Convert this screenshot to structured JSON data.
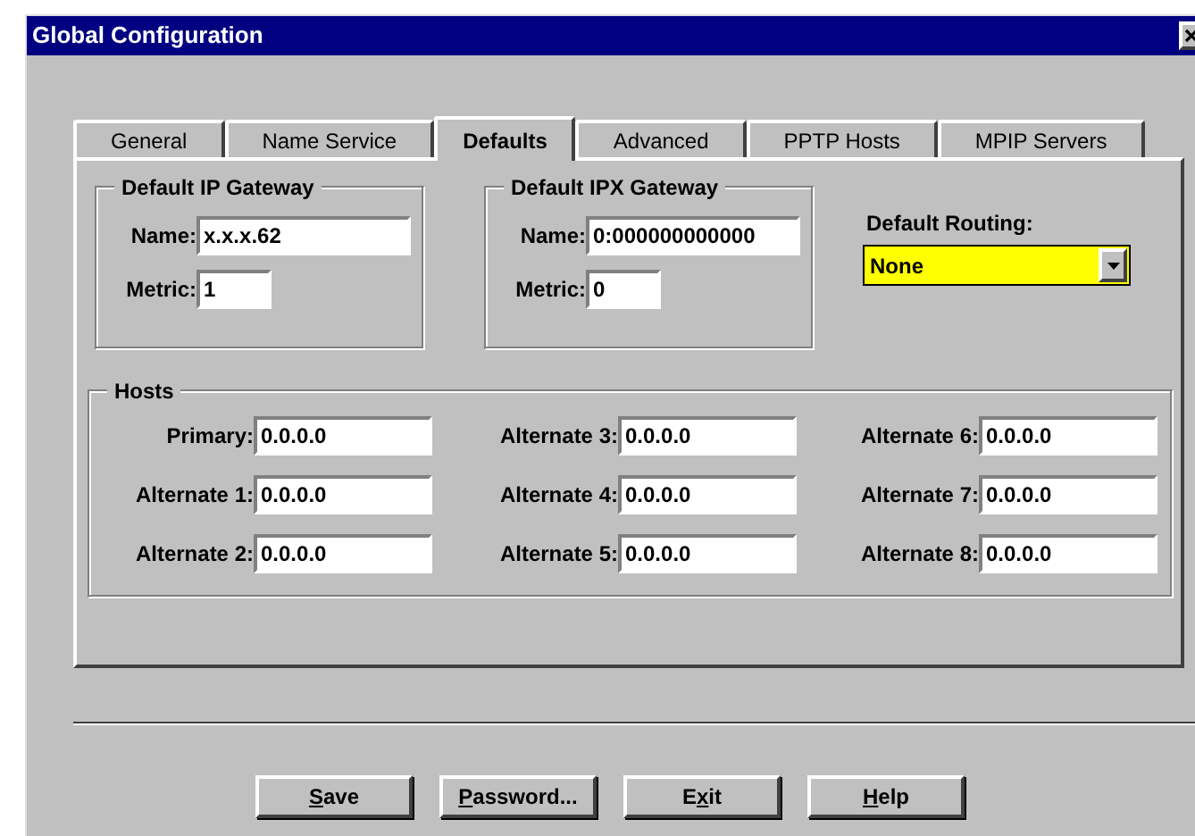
{
  "window": {
    "title": "Global Configuration"
  },
  "tabs": [
    {
      "label": "General",
      "selected": false
    },
    {
      "label": "Name Service",
      "selected": false
    },
    {
      "label": "Defaults",
      "selected": true
    },
    {
      "label": "Advanced",
      "selected": false
    },
    {
      "label": "PPTP Hosts",
      "selected": false
    },
    {
      "label": "MPIP Servers",
      "selected": false
    }
  ],
  "gateways": [
    {
      "title": "Default IP Gateway",
      "name_label": "Name:",
      "name_value": "x.x.x.62",
      "metric_label": "Metric:",
      "metric_value": "1"
    },
    {
      "title": "Default IPX Gateway",
      "name_label": "Name:",
      "name_value": "0:000000000000",
      "metric_label": "Metric:",
      "metric_value": "0"
    }
  ],
  "routing": {
    "label": "Default Routing:",
    "value": "None"
  },
  "hosts": {
    "title": "Hosts",
    "fields": [
      {
        "label": "Primary:",
        "value": "0.0.0.0"
      },
      {
        "label": "Alternate 3:",
        "value": "0.0.0.0"
      },
      {
        "label": "Alternate 6:",
        "value": "0.0.0.0"
      },
      {
        "label": "Alternate 1:",
        "value": "0.0.0.0"
      },
      {
        "label": "Alternate 4:",
        "value": "0.0.0.0"
      },
      {
        "label": "Alternate 7:",
        "value": "0.0.0.0"
      },
      {
        "label": "Alternate 2:",
        "value": "0.0.0.0"
      },
      {
        "label": "Alternate 5:",
        "value": "0.0.0.0"
      },
      {
        "label": "Alternate 8:",
        "value": "0.0.0.0"
      }
    ]
  },
  "buttons": [
    {
      "access_key": "S",
      "after": "ave"
    },
    {
      "access_key": "P",
      "after": "assword..."
    },
    {
      "before": "E",
      "access_key": "x",
      "after": "it"
    },
    {
      "access_key": "H",
      "after": "elp"
    }
  ]
}
